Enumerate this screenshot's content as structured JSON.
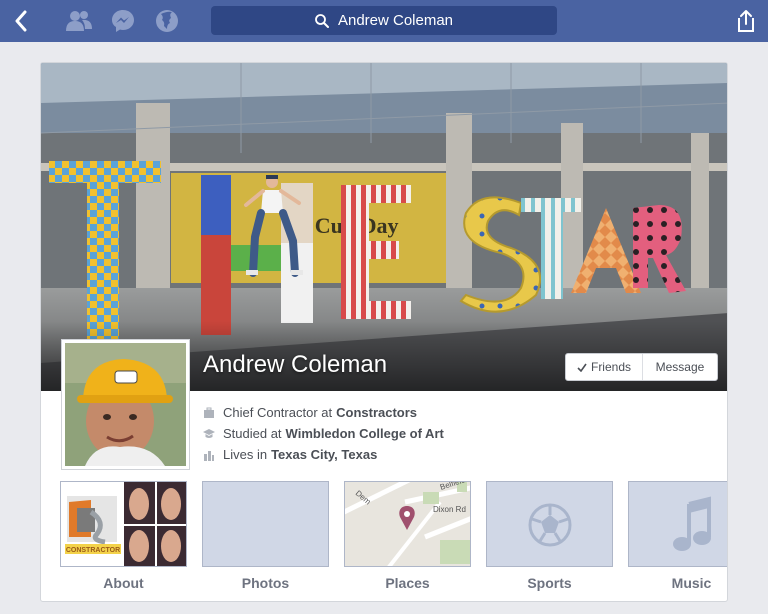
{
  "nav": {
    "search_value": "Andrew Coleman",
    "icons": [
      "back-icon",
      "friends-icon",
      "messenger-icon",
      "globe-icon",
      "share-icon"
    ]
  },
  "profile": {
    "name": "Andrew Coleman",
    "cover_letters": "THESTAR",
    "actions": {
      "friends": "Friends",
      "message": "Message"
    },
    "work": {
      "prefix": "Chief Contractor at",
      "value": "Constractors"
    },
    "education": {
      "prefix": "Studied at",
      "value": "Wimbledon College of Art"
    },
    "location": {
      "prefix": "Lives in",
      "value": "Texas City, Texas"
    }
  },
  "tiles": [
    {
      "label": "About",
      "thumb_text": "CONSTRACTOR"
    },
    {
      "label": "Photos"
    },
    {
      "label": "Places",
      "map_streets": [
        "Belfield",
        "Dixon Rd",
        "Dem"
      ]
    },
    {
      "label": "Sports"
    },
    {
      "label": "Music"
    }
  ],
  "colors": {
    "navbar": "#4a63a2",
    "search": "#2f4785",
    "background": "#e9eaee",
    "tile": "#d0d7e6"
  }
}
